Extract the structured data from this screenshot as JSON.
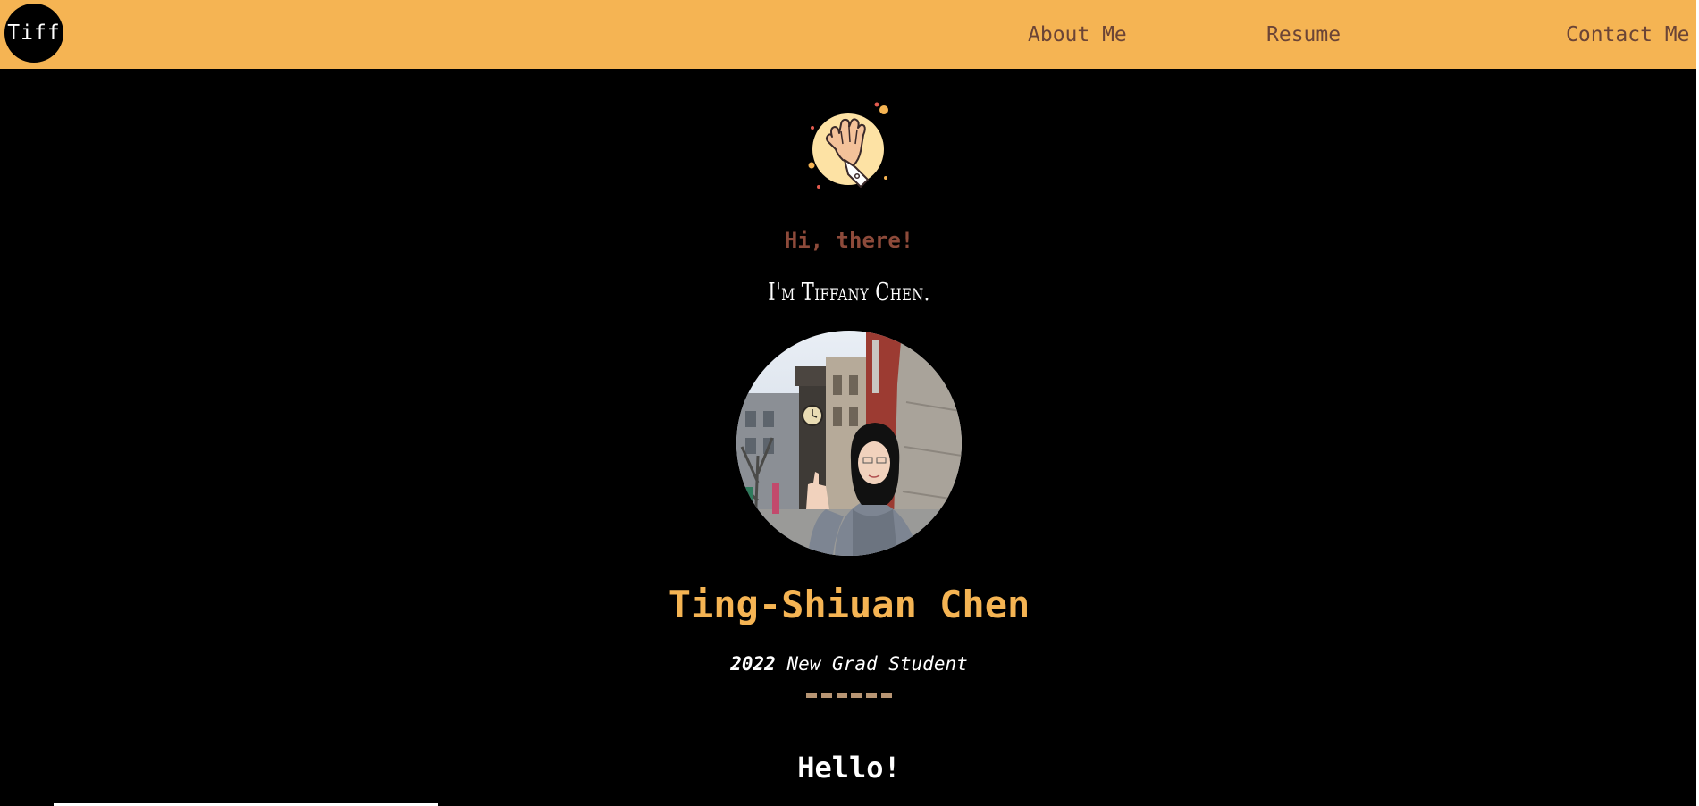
{
  "nav": {
    "logo_text": "Tiff",
    "links": [
      {
        "label": "About Me"
      },
      {
        "label": "Resume"
      },
      {
        "label": "Contact Me"
      }
    ]
  },
  "hero": {
    "greeting": "Hi, there!",
    "intro": "I'm Tiffany Chen.",
    "full_name": "Ting-Shiuan Chen",
    "subtitle_year": "2022",
    "subtitle_text": " New Grad Student",
    "section_heading": "Hello!"
  },
  "colors": {
    "accent": "#f5b453",
    "greeting": "#8d4a3a",
    "nav_text": "#6b4436",
    "background": "#000000",
    "divider": "#b79573"
  },
  "icons": {
    "wave": "waving-hand-icon",
    "profile": "profile-photo"
  }
}
